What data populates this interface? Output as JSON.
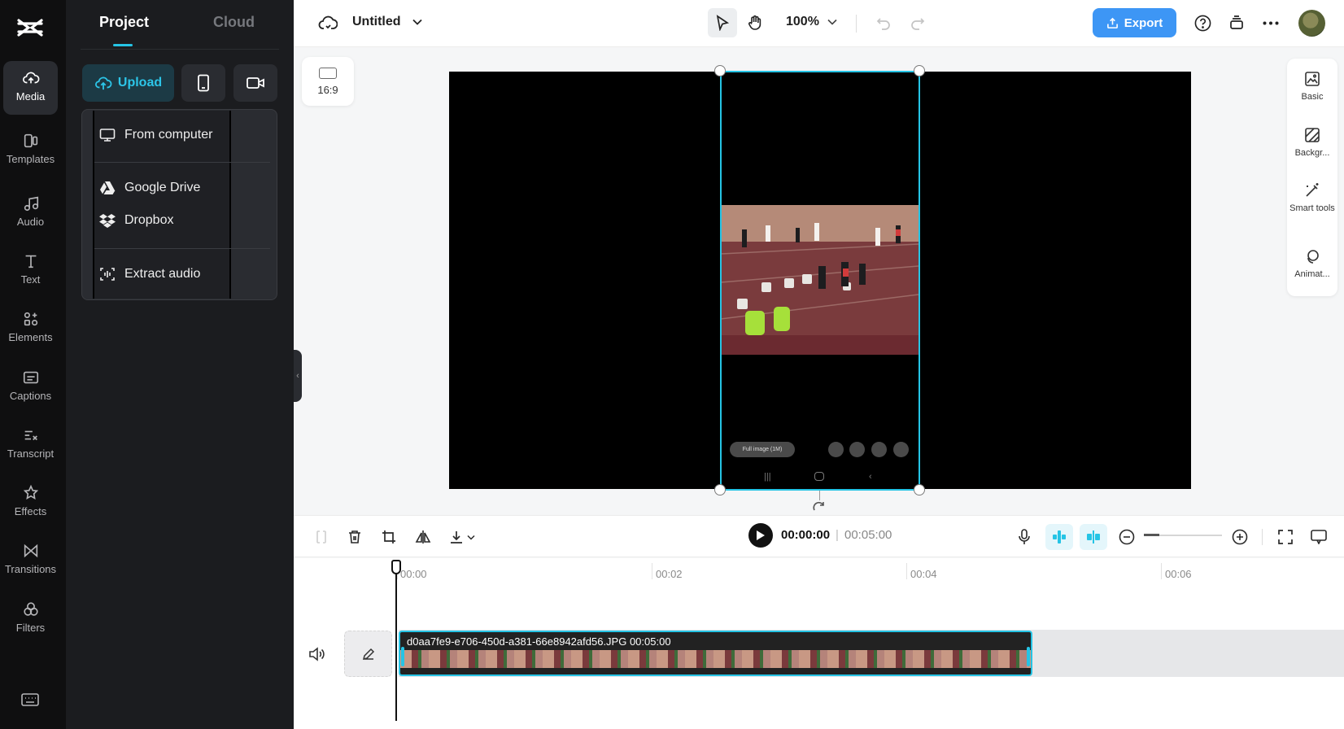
{
  "rail": {
    "items": [
      {
        "label": "Media"
      },
      {
        "label": "Templates"
      },
      {
        "label": "Audio"
      },
      {
        "label": "Text"
      },
      {
        "label": "Elements"
      },
      {
        "label": "Captions"
      },
      {
        "label": "Transcript"
      },
      {
        "label": "Effects"
      },
      {
        "label": "Transitions"
      },
      {
        "label": "Filters"
      }
    ]
  },
  "panel": {
    "tabs": [
      {
        "label": "Project"
      },
      {
        "label": "Cloud"
      }
    ],
    "upload_label": "Upload",
    "upload_menu": [
      {
        "label": "From computer",
        "icon": "monitor-icon"
      },
      {
        "label": "Google Drive",
        "icon": "google-drive-icon"
      },
      {
        "label": "Dropbox",
        "icon": "dropbox-icon"
      },
      {
        "label": "Extract audio",
        "icon": "extract-audio-icon"
      }
    ]
  },
  "topbar": {
    "title": "Untitled",
    "zoom": "100%",
    "export_label": "Export"
  },
  "stage": {
    "aspect_ratio": "16:9",
    "phone_pill_text": "Full image (1M)"
  },
  "properties": {
    "items": [
      {
        "label": "Basic"
      },
      {
        "label": "Backgr..."
      },
      {
        "label": "Smart tools"
      },
      {
        "label": "Animat..."
      }
    ]
  },
  "timeline": {
    "current_time": "00:00:00",
    "separator": "|",
    "total_time": "00:05:00",
    "ruler": [
      "00:00",
      "00:02",
      "00:04",
      "00:06"
    ],
    "zoom_level": 0.2,
    "clip": {
      "label": "d0aa7fe9-e706-450d-a381-66e8942afd56.JPG   00:05:00"
    }
  },
  "colors": {
    "accent": "#25c4e5",
    "export": "#3d96f5",
    "rail_bg": "#0f0f10",
    "panel_bg": "#1b1c1f"
  }
}
